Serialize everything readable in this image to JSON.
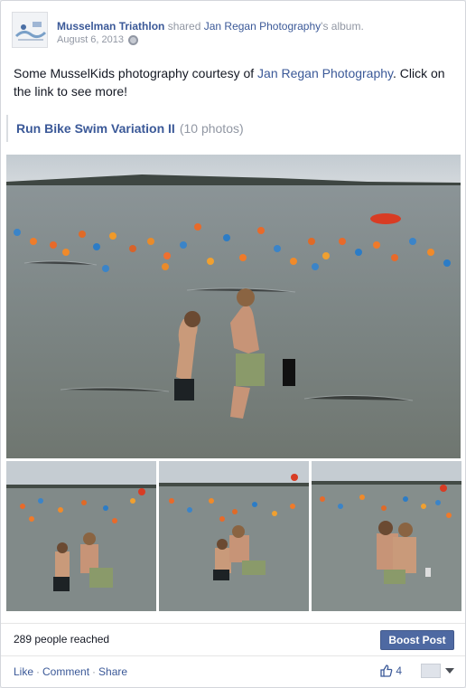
{
  "header": {
    "page_name": "Musselman Triathlon",
    "action_text": " shared ",
    "source_name": "Jan Regan Photography",
    "possessive": "'s album.",
    "date": "August 6, 2013",
    "privacy_icon": "globe-icon"
  },
  "post": {
    "text_before": "Some MusselKids photography courtesy of ",
    "text_link": "Jan Regan Photography",
    "text_after": ". Click on the link to see more!"
  },
  "album": {
    "title": "Run Bike Swim Variation II",
    "count": "(10 photos)"
  },
  "stats": {
    "reached": "289 people reached",
    "boost_label": "Boost Post"
  },
  "actions": {
    "like": "Like",
    "comment": "Comment",
    "share": "Share",
    "separator": "·",
    "like_count": "4",
    "like_icon": "thumbs-up-icon"
  },
  "colors": {
    "link": "#3b5998",
    "muted": "#9197a3",
    "boost_bg": "#4e69a2"
  }
}
